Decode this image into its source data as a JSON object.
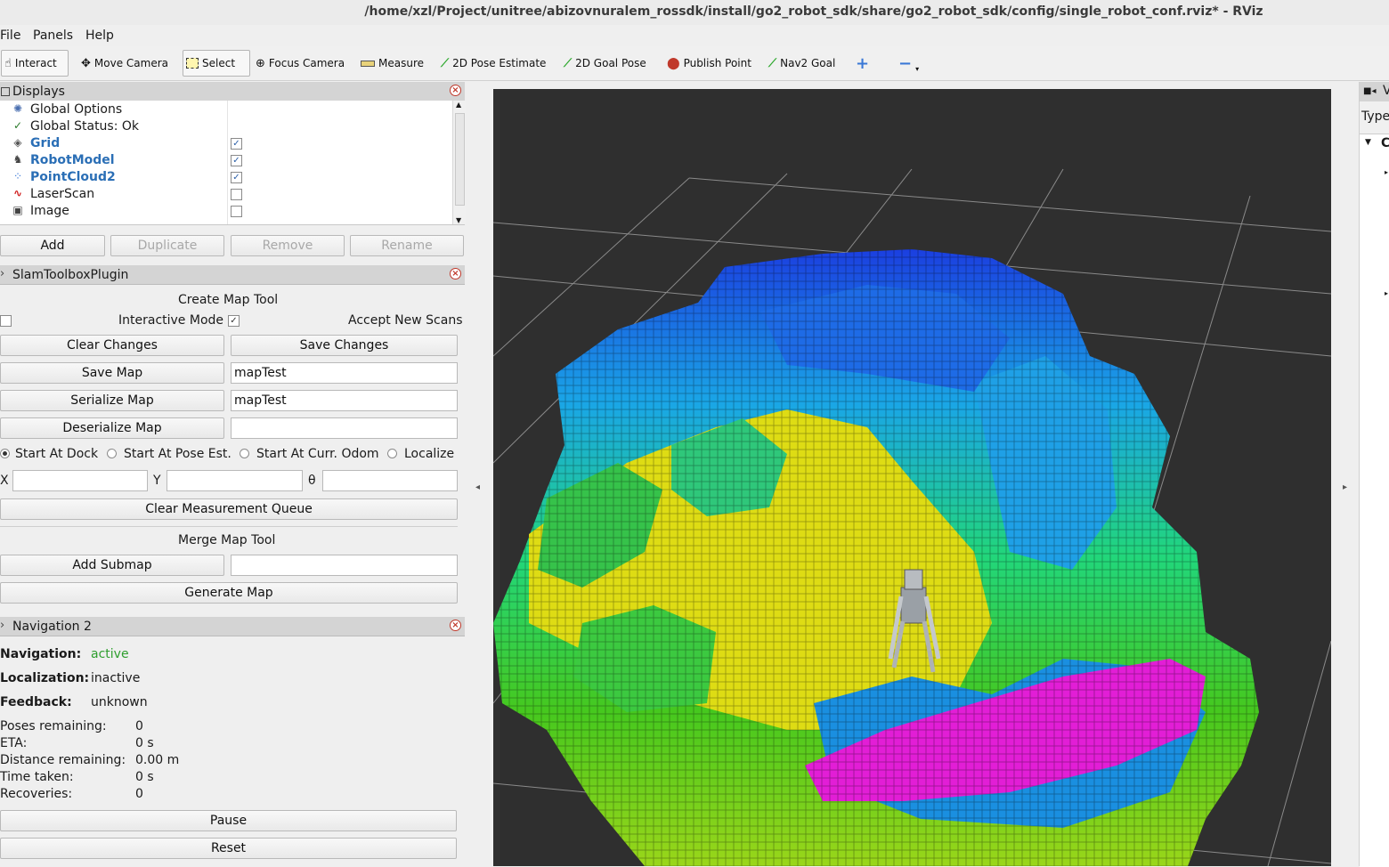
{
  "window": {
    "title": "/home/xzl/Project/unitree/abizovnuralem_rossdk/install/go2_robot_sdk/share/go2_robot_sdk/config/single_robot_conf.rviz* - RViz"
  },
  "menu": [
    "File",
    "Panels",
    "Help"
  ],
  "toolbar": {
    "interact": "Interact",
    "move_camera": "Move Camera",
    "select": "Select",
    "focus_camera": "Focus Camera",
    "measure": "Measure",
    "pose_estimate": "2D Pose Estimate",
    "goal_pose": "2D Goal Pose",
    "publish_point": "Publish Point",
    "nav2_goal": "Nav2 Goal"
  },
  "displays": {
    "title": "Displays",
    "items": [
      {
        "label": "Global Options",
        "icon": "gear-icon"
      },
      {
        "label": "Global Status: Ok",
        "icon": "check-icon"
      },
      {
        "label": "Grid",
        "icon": "grid-icon",
        "checked": true
      },
      {
        "label": "RobotModel",
        "icon": "robot-icon",
        "checked": true
      },
      {
        "label": "PointCloud2",
        "icon": "pointcloud-icon",
        "checked": true
      },
      {
        "label": "LaserScan",
        "icon": "laserscan-icon",
        "checked": false
      },
      {
        "label": "Image",
        "icon": "image-icon",
        "checked": false
      }
    ],
    "buttons": {
      "add": "Add",
      "duplicate": "Duplicate",
      "remove": "Remove",
      "rename": "Rename"
    }
  },
  "slam": {
    "title": "SlamToolboxPlugin",
    "create_map_tool": "Create Map Tool",
    "interactive_mode": "Interactive Mode",
    "accept_new_scans": "Accept New Scans",
    "clear_changes": "Clear Changes",
    "save_changes": "Save Changes",
    "save_map": "Save Map",
    "save_map_value": "mapTest",
    "serialize_map": "Serialize Map",
    "serialize_map_value": "mapTest",
    "deserialize_map": "Deserialize Map",
    "deserialize_map_value": "",
    "radios": [
      "Start At Dock",
      "Start At Pose Est.",
      "Start At Curr. Odom",
      "Localize"
    ],
    "x_label": "X",
    "y_label": "Y",
    "theta_label": "θ",
    "clear_queue": "Clear Measurement Queue",
    "merge_map_tool": "Merge Map Tool",
    "add_submap": "Add Submap",
    "add_submap_value": "",
    "generate_map": "Generate Map"
  },
  "nav2": {
    "title": "Navigation 2",
    "navigation_label": "Navigation:",
    "navigation_value": "active",
    "localization_label": "Localization:",
    "localization_value": "inactive",
    "feedback_label": "Feedback:",
    "feedback_value": "unknown",
    "poses_remaining_label": "Poses remaining:",
    "poses_remaining_value": "0",
    "eta_label": "ETA:",
    "eta_value": "0 s",
    "distance_label": "Distance remaining:",
    "distance_value": "0.00 m",
    "time_label": "Time taken:",
    "time_value": "0 s",
    "recoveries_label": "Recoveries:",
    "recoveries_value": "0",
    "pause": "Pause",
    "reset": "Reset",
    "active_color": "#2e9e2e"
  },
  "right_panel": {
    "title": "V",
    "type_label": "Type"
  }
}
